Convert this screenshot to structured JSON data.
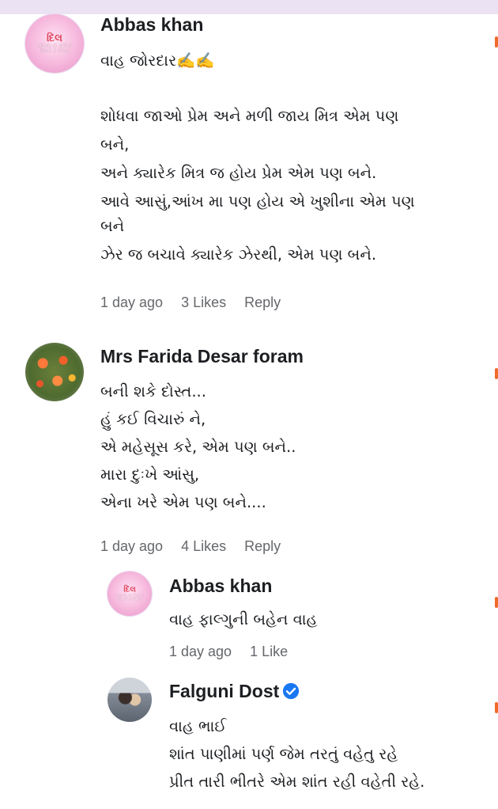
{
  "comments": [
    {
      "name": "Abbas khan",
      "avatar_text": [
        "દિલ",
        "કવિઓ ની સ્ટેપિકો",
        "લિખને કે વિચાર"
      ],
      "lines": [
        "વાહ જોરદાર✍️✍️",
        "",
        "શોધવા જાઓ પ્રેમ અને મળી જાય મિત્ર એમ પણ",
        "બને,",
        "અને ક્યારેક મિત્ર જ હોય પ્રેમ એમ પણ બને.",
        "આવે આસું,આંખ મા પણ હોય એ ખુશીના એમ પણ",
        "બને",
        "ઝેર જ બચાવે ક્યારેક  ઝેરથી, એમ પણ બને."
      ],
      "time": "1 day ago",
      "likes": "3 Likes",
      "reply": "Reply"
    },
    {
      "name": "Mrs Farida Desar foram",
      "lines": [
        "બની શકે દોસ્ત...",
        "હું કઈ વિચારું ને,",
        "એ મહેસૂસ કરે, એમ પણ બને..",
        "મારા દુઃખે આંસુ,",
        "એના ખરે એમ પણ બને...."
      ],
      "time": "1 day ago",
      "likes": "4 Likes",
      "reply": "Reply"
    },
    {
      "name": "Abbas khan",
      "avatar_text": [
        "દિલ",
        "કવિઓ ની સ્ટેપિકો",
        "લિખને કે વિચાર"
      ],
      "lines": [
        "વાહ ફાલ્ગુની બહેન વાહ"
      ],
      "time": "1 day ago",
      "likes": "1 Like"
    },
    {
      "name": "Falguni Dost",
      "verified_icon": "verified-badge-icon",
      "lines": [
        "વાહ ભાઈ",
        "શાંત પાણીમાં પર્ણ જેમ તરતું વહેતુ રહે",
        "પ્રીત તારી ભીતરે એમ શાંત રહી વહેતી રહે."
      ]
    }
  ],
  "colors": {
    "accent_verified": "#1877f2",
    "meta_text": "#65676b",
    "edge_marker": "#f06a2c"
  }
}
